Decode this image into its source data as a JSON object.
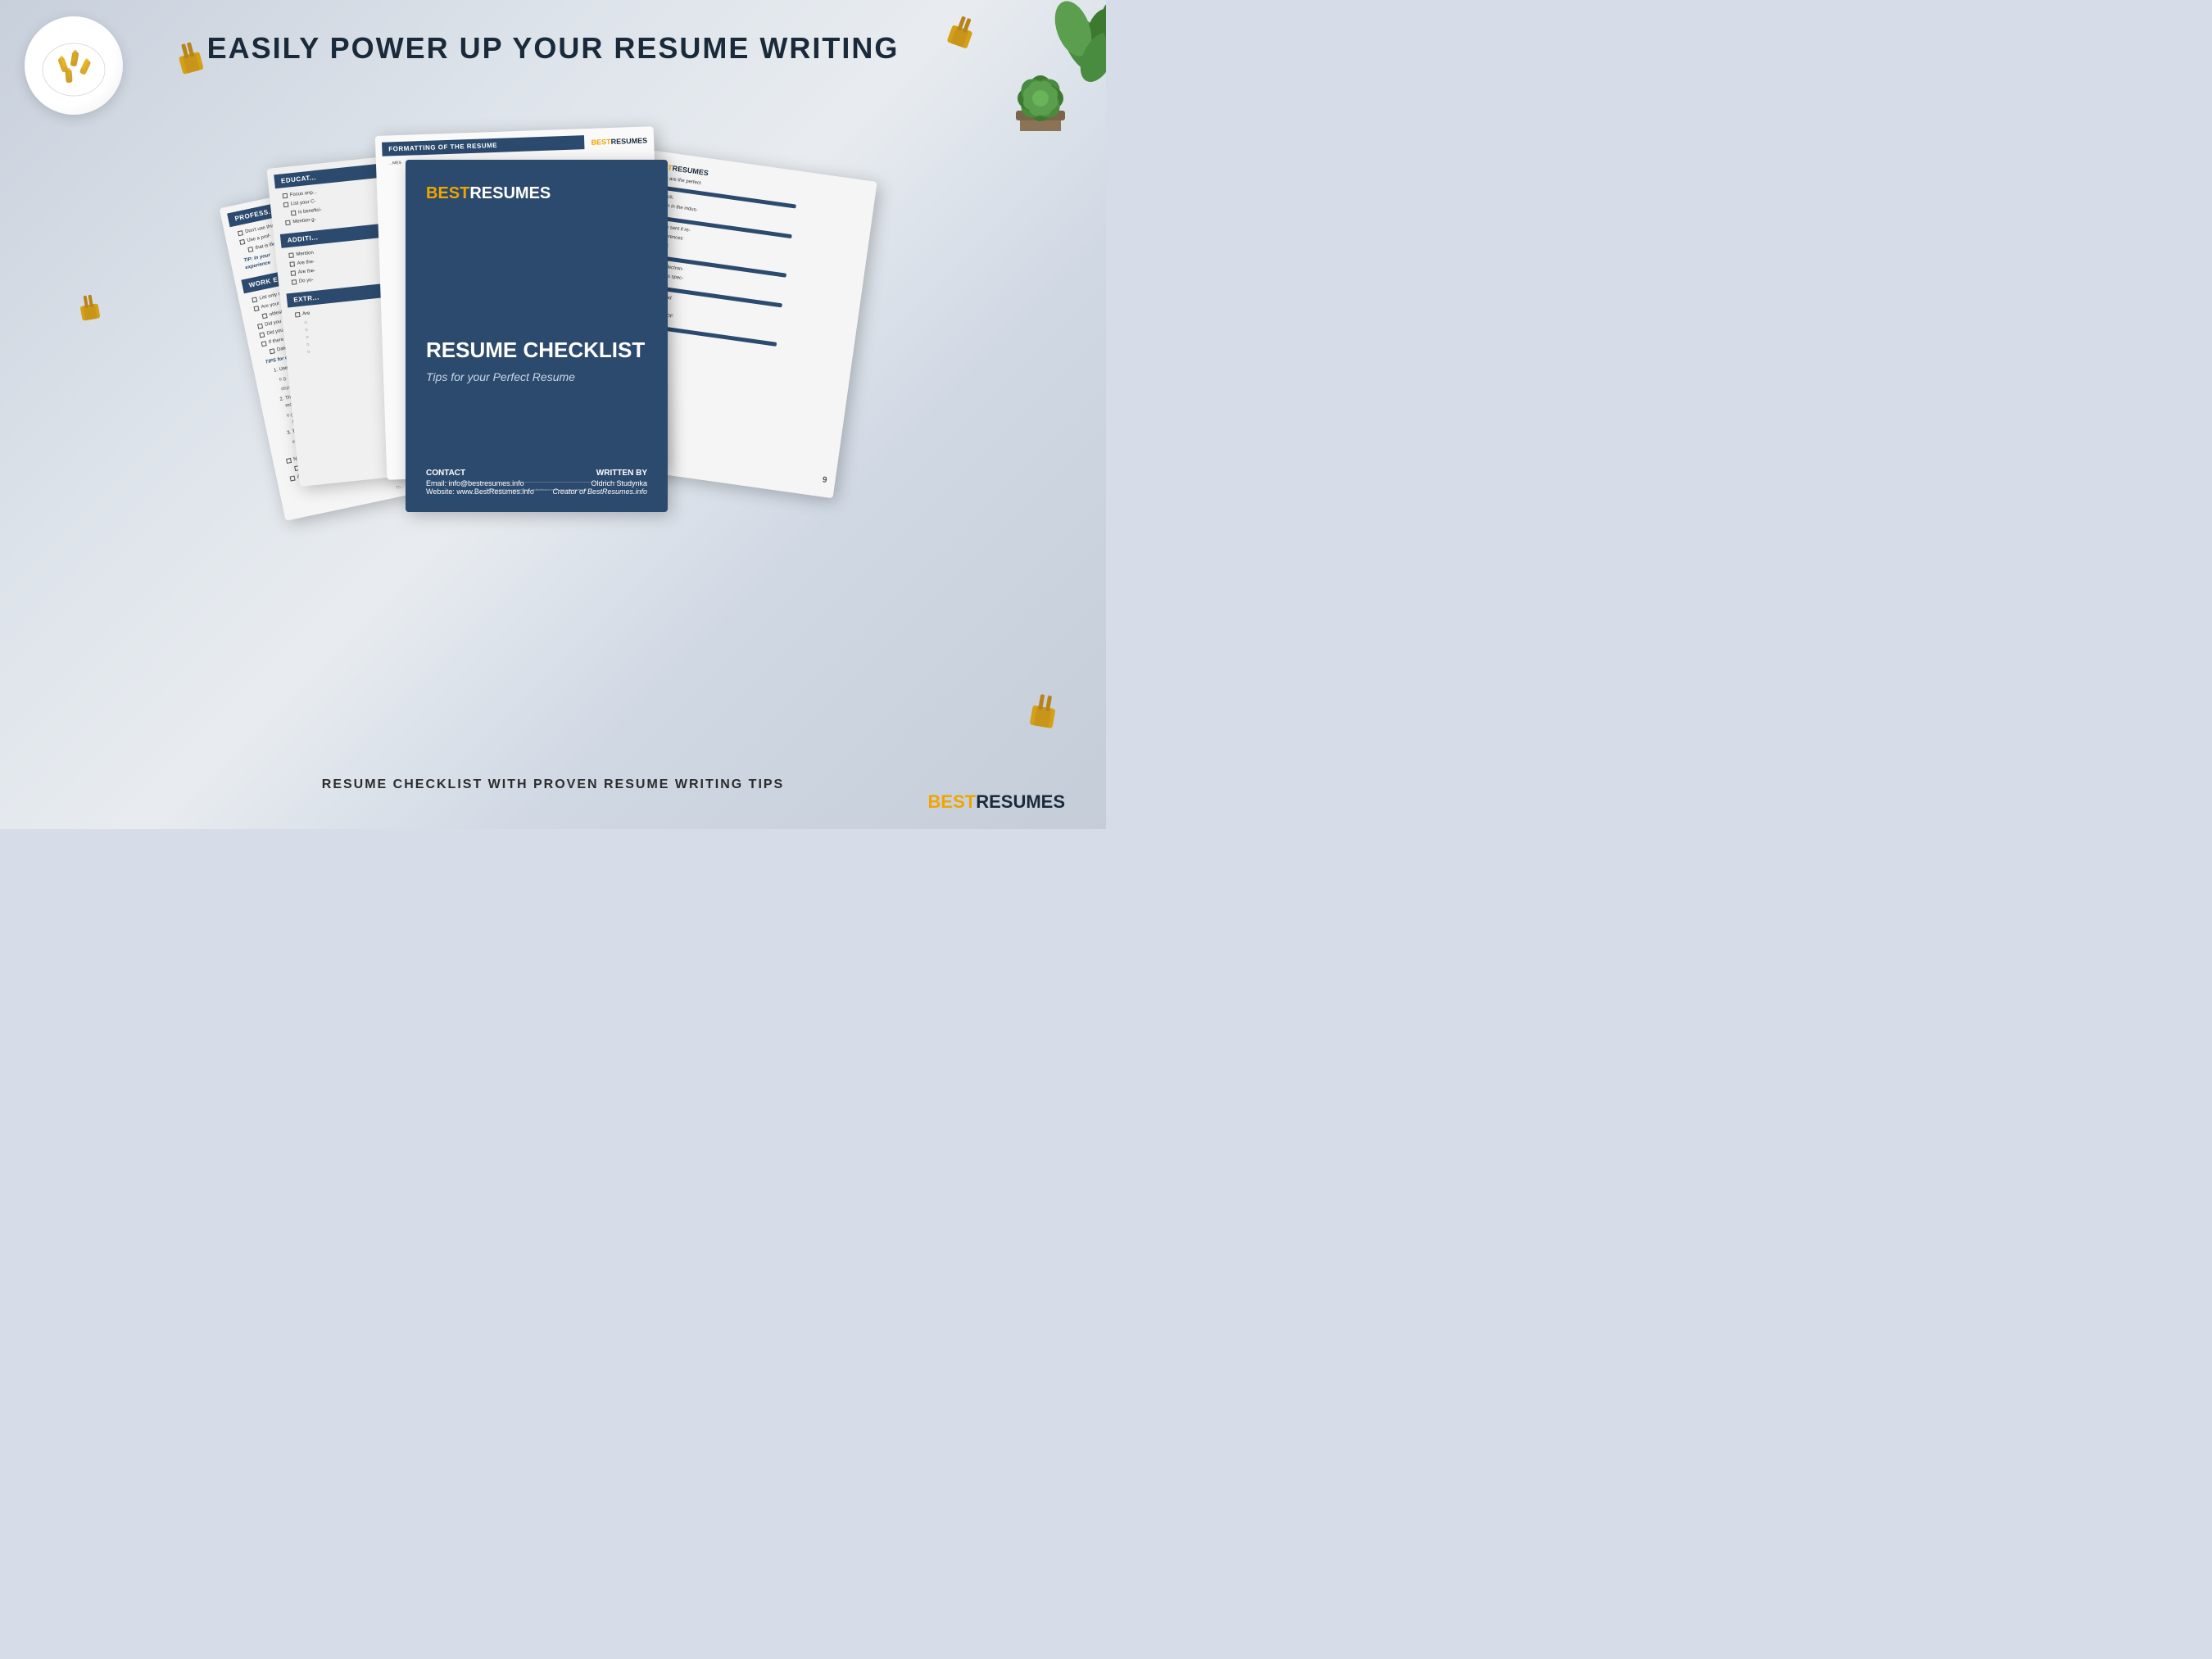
{
  "page": {
    "background_color": "#d6dde8",
    "main_heading": "EASILY POWER UP YOUR RESUME WRITING",
    "bottom_subheading": "RESUME CHECKLIST WITH PROVEN RESUME WRITING TIPS",
    "brand": {
      "best": "BEST",
      "resumes": "RESUMES"
    }
  },
  "cover": {
    "brand_best": "BEST",
    "brand_resumes": "RESUMES",
    "title": "RESUME CHECKLIST",
    "subtitle": "Tips for your Perfect Resume",
    "contact_label": "CONTACT",
    "contact_email": "Email: info@bestresumes.info",
    "contact_website": "Website: www.BestResumes.info",
    "written_by_label": "WRITTEN BY",
    "written_by_name": "Oldrich Studynka",
    "written_by_title": "Creator of BestResumes.info"
  },
  "pages": {
    "formatting_header": "FORMATTING OF THE RESUME",
    "education_header": "EDUCAT...",
    "professional_header": "PROFESS...",
    "work_header": "WORK E...",
    "additional_header": "ADDITI...",
    "extra_header": "EXTR...",
    "focus_on_text": "Focus on",
    "list_items": [
      "Don't use this",
      "Use a prof-",
      "that is like a"
    ],
    "tip_text": "TIP: In your experience",
    "work_items": [
      "List only re-",
      "Are your jo-",
      "oldest one",
      "Did you in-",
      "Did you ul-",
      "If there is a",
      "Dates, title"
    ]
  },
  "decorations": {
    "clip_unicode": "📎",
    "plant_color": "#4a8c3f"
  }
}
